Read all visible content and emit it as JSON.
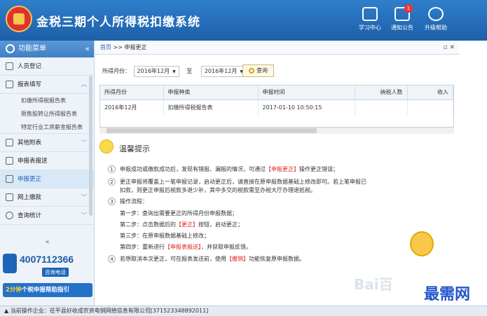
{
  "app": {
    "title": "金税三期个人所得税扣缴系统"
  },
  "topbar": {
    "learn": "学习中心",
    "notice": "通知公告",
    "notice_badge": "1",
    "upgrade": "升级帮助"
  },
  "sidebar": {
    "header": "功能菜单",
    "items": [
      {
        "label": "人员登记"
      },
      {
        "label": "报表填写"
      },
      {
        "label": "扣缴所得税报告表"
      },
      {
        "label": "限售股转让所得报告表"
      },
      {
        "label": "特定行业工资薪金报告表"
      },
      {
        "label": "其他附表"
      },
      {
        "label": "申报表报送"
      },
      {
        "label": "申报更正"
      },
      {
        "label": "网上缴款"
      },
      {
        "label": "查询统计"
      }
    ],
    "phone": "4007112366",
    "phone_label": "咨询电话",
    "promo_a": "2分钟",
    "promo_b": "个税申报帮助指引"
  },
  "breadcrumb": {
    "home": "首页",
    "sep": ">>",
    "page": "申报更正"
  },
  "filter": {
    "label": "所得月份：",
    "from": "2016年12月",
    "to_label": "至",
    "to": "2016年12月",
    "query": "查询"
  },
  "table": {
    "columns": [
      "所得月份",
      "申报种类",
      "申报时间",
      "纳税人数",
      "收入"
    ],
    "rows": [
      [
        "2016年12月",
        "扣缴所得税报告表",
        "2017-01-10 10:50:15",
        "",
        ""
      ]
    ]
  },
  "tips": {
    "title": "温馨提示",
    "t1a": "申报成功或缴款成功后，发现有错报、漏报的情况，可通过",
    "t1b": "【申报更正】",
    "t1c": "操作更正错误；",
    "t2a": "更正申报将覆盖上一笔申报记录，启动更正后，请直接在原申报数据基础上修改即可。若上笔申报已",
    "t2b": "扣款，则更正申报后税款多退少补，其中多交的税款需至办税大厅办理退抵税。",
    "t3": "操作流程：",
    "s1": "第一步：查询出需要更正的所得月份申报数据；",
    "s2a": "第二步：点击数据后的",
    "s2b": "【更正】",
    "s2c": "按钮，启动更正；",
    "s3": "第三步：在原申报数据基础上修改；",
    "s4a": "第四步：重新进行",
    "s4b": "【申报表报送】",
    "s4c": "，并获取申报反馈。",
    "t4a": "若想取消本次更正，可在报表发送前，使用",
    "t4b": "【撤销】",
    "t4c": "功能恢复原申报数据。"
  },
  "statusbar": {
    "text": "当前操作企业：茌平县好收成农资电销网络信息有限公司[371523348892011]"
  },
  "watermark": "最需网"
}
